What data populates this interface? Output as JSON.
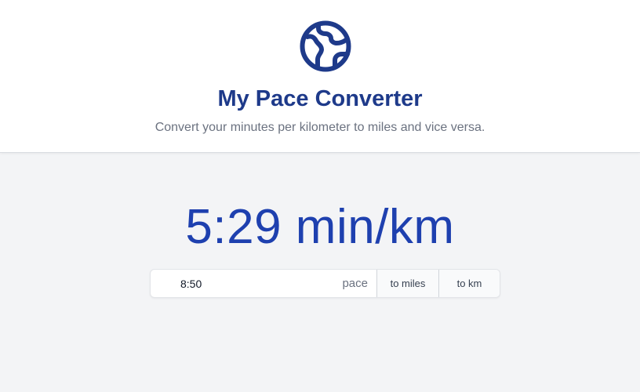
{
  "header": {
    "logo_icon": "globe-icon",
    "title": "My Pace Converter",
    "subtitle": "Convert your minutes per kilometer to miles and vice versa."
  },
  "result": {
    "text": "5:29 min/km"
  },
  "form": {
    "pace_value": "8:50",
    "pace_label": "pace",
    "to_miles_label": "to miles",
    "to_km_label": "to km"
  },
  "colors": {
    "accent": "#1e3a8a",
    "result": "#1e40af",
    "background": "#f3f4f6"
  }
}
